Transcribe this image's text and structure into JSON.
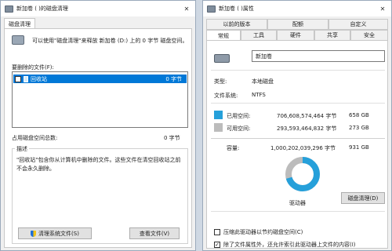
{
  "left_window": {
    "title": "新加卷 (  )的磁盘清理",
    "tab": "磁盘清理",
    "intro": "可以使用\"磁盘清理\"来释放 新加卷 (D:) 上的 0 字节 磁盘空间。",
    "files_label": "要删除的文件(F):",
    "files": [
      {
        "name": "回收站",
        "size": "0 字节",
        "checked": false
      }
    ],
    "total_label": "占用磁盘空间总数:",
    "total_value": "0 字节",
    "desc_label": "描述",
    "desc_text": "\"回收站\"包含你从计算机中删除的文件。这些文件在清空回收站之前不会永久删除。",
    "clean_system_button": "清理系统文件(S)",
    "view_files_button": "查看文件(V)",
    "close_glyph": "✕"
  },
  "right_window": {
    "title": "新加卷 (   )属性",
    "tabs_row1": [
      "以前的版本",
      "配额",
      "自定义"
    ],
    "tabs_row2": [
      "常规",
      "工具",
      "硬件",
      "共享",
      "安全"
    ],
    "volume_name": "新加卷",
    "type_label": "类型:",
    "type_value": "本地磁盘",
    "fs_label": "文件系统:",
    "fs_value": "NTFS",
    "used_label": "已用空间:",
    "used_bytes": "706,608,574,464 字节",
    "used_gb": "658 GB",
    "free_label": "可用空间:",
    "free_bytes": "293,593,464,832 字节",
    "free_gb": "273 GB",
    "capacity_label": "容量:",
    "capacity_bytes": "1,000,202,039,296 字节",
    "capacity_gb": "931 GB",
    "used_fraction": 0.706,
    "drive_label": "驱动器",
    "cleanup_button": "磁盘清理(D)",
    "compress_label": "压缩此驱动器以节约磁盘空间(C)",
    "compress_checked": false,
    "index_label": "除了文件属性外，还允许索引此驱动器上文件的内容(I)",
    "index_checked": true,
    "close_glyph": "✕",
    "used_color": "#26a0da",
    "free_color": "#bcbcbc"
  }
}
